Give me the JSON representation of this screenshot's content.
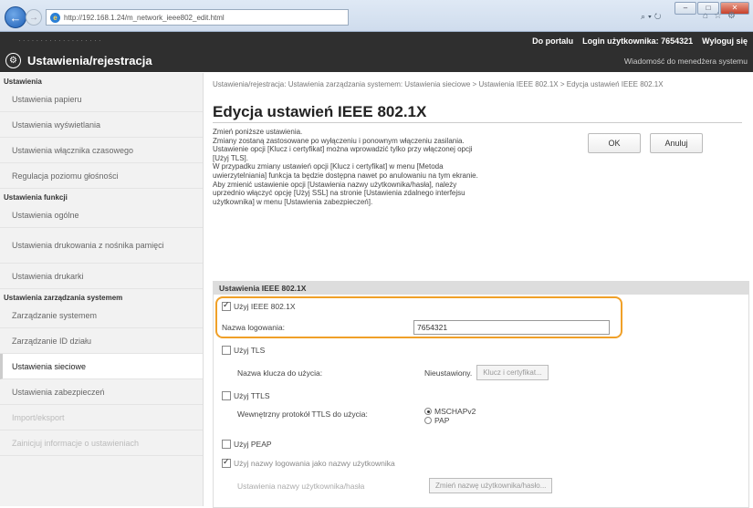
{
  "browser": {
    "url": "http://192.168.1.24/m_network_ieee802_edit.html",
    "window_controls": [
      "–",
      "□",
      "✕"
    ]
  },
  "topbar": {
    "host_info": "· · · · · · ·      · · · · · · · · · · · ·",
    "portal_link": "Do portalu",
    "login_label": "Login użytkownika:",
    "login_value": "7654321",
    "logout": "Wyloguj się",
    "title": "Ustawienia/rejestracja",
    "admin_msg": "Wiadomość do menedżera systemu"
  },
  "sidebar": {
    "sections": [
      {
        "head": "Ustawienia",
        "items": [
          "Ustawienia papieru",
          "Ustawienia wyświetlania",
          "Ustawienia włącznika czasowego",
          "Regulacja poziomu głośności"
        ]
      },
      {
        "head": "Ustawienia funkcji",
        "items": [
          "Ustawienia ogólne",
          "Ustawienia drukowania z nośnika pamięci",
          "Ustawienia drukarki"
        ]
      },
      {
        "head": "Ustawienia zarządzania systemem",
        "items": [
          "Zarządzanie systemem",
          "Zarządzanie ID działu",
          "Ustawienia sieciowe",
          "Ustawienia zabezpieczeń",
          "Import/eksport",
          "Zainicjuj informacje o ustawieniach"
        ]
      }
    ]
  },
  "main": {
    "breadcrumb": "Ustawienia/rejestracja: Ustawienia zarządzania systemem: Ustawienia sieciowe > Ustawienia IEEE 802.1X > Edycja ustawień IEEE 802.1X",
    "title": "Edycja ustawień IEEE 802.1X",
    "description": [
      "Zmień poniższe ustawienia.",
      "Zmiany zostaną zastosowane po wyłączeniu i ponownym włączeniu zasilania.",
      "Ustawienie opcji [Klucz i certyfikat] można wprowadzić tylko przy włączonej opcji",
      "[Użyj TLS].",
      "W przypadku zmiany ustawień opcji [Klucz i certyfikat] w menu [Metoda",
      "uwierzytelniania] funkcja ta będzie dostępna nawet po anulowaniu na tym ekranie.",
      "Aby zmienić ustawienie opcji [Ustawienia nazwy użytkownika/hasła], należy",
      "uprzednio włączyć opcję [Użyj SSL] na stronie [Ustawienia zdalnego interfejsu",
      "użytkownika] w menu [Ustawienia zabezpieczeń]."
    ],
    "ok": "OK",
    "cancel": "Anuluj",
    "panel_title": "Ustawienia IEEE 802.1X",
    "use_ieee": "Użyj IEEE 802.1X",
    "login_name_label": "Nazwa logowania:",
    "login_name_value": "7654321",
    "use_tls": "Użyj TLS",
    "key_name_label": "Nazwa klucza do użycia:",
    "key_name_value": "Nieustawiony.",
    "key_cert_button": "Klucz i certyfikat...",
    "use_ttls": "Użyj TTLS",
    "ttls_protocol_label": "Wewnętrzny protokół TTLS do użycia:",
    "ttls_opt1": "MSCHAPv2",
    "ttls_opt2": "PAP",
    "use_peap": "Użyj PEAP",
    "use_login_as_user": "Użyj nazwy logowania jako nazwy użytkownika",
    "user_pass_label": "Ustawienia nazwy użytkownika/hasła",
    "user_pass_button": "Zmień nazwę użytkownika/hasło..."
  }
}
